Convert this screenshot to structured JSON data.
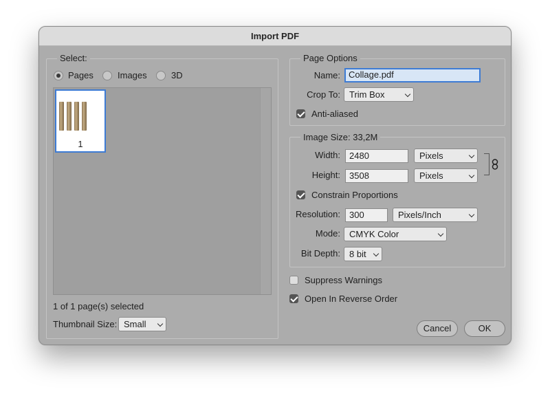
{
  "window": {
    "title": "Import PDF"
  },
  "select": {
    "legend": "Select:",
    "options": [
      {
        "label": "Pages",
        "selected": true
      },
      {
        "label": "Images",
        "selected": false
      },
      {
        "label": "3D",
        "selected": false
      }
    ],
    "thumbnail": {
      "page_number": "1"
    },
    "status": "1 of 1 page(s) selected",
    "thumbnail_size": {
      "label": "Thumbnail Size:",
      "value": "Small"
    }
  },
  "page_options": {
    "legend": "Page Options",
    "name": {
      "label": "Name:",
      "value": "Collage.pdf"
    },
    "crop_to": {
      "label": "Crop To:",
      "value": "Trim Box"
    },
    "anti_aliased": {
      "label": "Anti-aliased",
      "checked": true
    }
  },
  "image_size": {
    "legend": "Image Size: 33,2M",
    "width": {
      "label": "Width:",
      "value": "2480",
      "unit": "Pixels"
    },
    "height": {
      "label": "Height:",
      "value": "3508",
      "unit": "Pixels"
    },
    "link_icon": "chain-link-icon",
    "constrain": {
      "label": "Constrain Proportions",
      "checked": true
    },
    "resolution": {
      "label": "Resolution:",
      "value": "300",
      "unit": "Pixels/Inch"
    },
    "mode": {
      "label": "Mode:",
      "value": "CMYK Color"
    },
    "bit_depth": {
      "label": "Bit Depth:",
      "value": "8 bit"
    }
  },
  "suppress_warnings": {
    "label": "Suppress Warnings",
    "checked": false
  },
  "reverse_order": {
    "label": "Open In Reverse Order",
    "checked": true
  },
  "buttons": {
    "cancel": "Cancel",
    "ok": "OK"
  },
  "colors": {
    "accent": "#3d7bd4",
    "dialog_bg": "#acacac"
  }
}
